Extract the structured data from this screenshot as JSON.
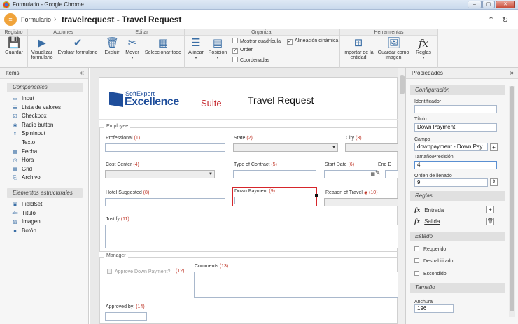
{
  "window": {
    "title": "Formulario - Google Chrome"
  },
  "header": {
    "breadcrumb": "Formulario",
    "separator": "›",
    "title": "travelrequest - Travel Request"
  },
  "ribbon": {
    "groups": {
      "registro": "Registro",
      "acciones": "Acciones",
      "editar": "Editar",
      "organizar": "Organizar",
      "herramientas": "Herramientas"
    },
    "buttons": {
      "guardar": "Guardar",
      "visualizar": "Visualizar formulario",
      "evaluar": "Evaluar formulario",
      "excluir": "Excluir",
      "mover": "Mover",
      "seleccionar": "Seleccionar todo",
      "alinear": "Alinear",
      "posicion": "Posición",
      "importar": "Importar de la entidad",
      "guardar_imagen": "Guardar como imagen",
      "reglas": "Reglas"
    },
    "checks": {
      "mostrar_cuadricula": {
        "label": "Mostrar cuadrícula",
        "checked": false
      },
      "orden": {
        "label": "Orden",
        "checked": true
      },
      "coordenadas": {
        "label": "Coordenadas",
        "checked": false
      },
      "alineacion": {
        "label": "Alineación dinámica",
        "checked": true
      }
    }
  },
  "items_panel": {
    "title": "Items",
    "components_title": "Componentes",
    "components": [
      {
        "icon": "input-icon",
        "label": "Input"
      },
      {
        "icon": "list-icon",
        "label": "Lista de valores"
      },
      {
        "icon": "checkbox-icon",
        "label": "Checkbox"
      },
      {
        "icon": "radio-icon",
        "label": "Radio button"
      },
      {
        "icon": "spin-icon",
        "label": "SpinInput"
      },
      {
        "icon": "text-icon",
        "label": "Texto"
      },
      {
        "icon": "calendar-icon",
        "label": "Fecha"
      },
      {
        "icon": "clock-icon",
        "label": "Hora"
      },
      {
        "icon": "grid-icon",
        "label": "Grid"
      },
      {
        "icon": "paperclip-icon",
        "label": "Archivo"
      }
    ],
    "structural_title": "Elementos estructurales",
    "structural": [
      {
        "icon": "fieldset-icon",
        "label": "FieldSet"
      },
      {
        "icon": "title-icon",
        "label": "Título"
      },
      {
        "icon": "image-icon",
        "label": "Imagen"
      },
      {
        "icon": "button-icon",
        "label": "Botón"
      }
    ]
  },
  "form": {
    "logo": {
      "line1": "SoftExpert",
      "line2": "Excellence",
      "line3": "Suite"
    },
    "title": "Travel Request",
    "employee_legend": "Employee",
    "manager_legend": "Manager",
    "fields": {
      "professional": {
        "label": "Professional",
        "num": "(1)"
      },
      "state": {
        "label": "State",
        "num": "(2)"
      },
      "city": {
        "label": "City",
        "num": "(3)"
      },
      "cost_center": {
        "label": "Cost Center",
        "num": "(4)"
      },
      "type_contract": {
        "label": "Type of Contract",
        "num": "(5)"
      },
      "start_date": {
        "label": "Start Date",
        "num": "(6)"
      },
      "end_date": {
        "label": "End D"
      },
      "hotel": {
        "label": "Hotel Suggested",
        "num": "(8)"
      },
      "down_payment": {
        "label": "Down Payment",
        "num": "(9)"
      },
      "reason": {
        "label": "Reason of Travel",
        "num": "(10)"
      },
      "justify": {
        "label": "Justify",
        "num": "(11)"
      },
      "approve": {
        "label": "Approve Down Payment?",
        "num": "(12)"
      },
      "comments": {
        "label": "Comments",
        "num": "(13)"
      },
      "approved_by": {
        "label": "Approved by:",
        "num": "(14)"
      }
    }
  },
  "properties_panel": {
    "title": "Propiedades",
    "config_title": "Configuración",
    "identificador": {
      "label": "Identificador",
      "value": ""
    },
    "titulo": {
      "label": "Título",
      "value": "Down Payment"
    },
    "campo": {
      "label": "Campo",
      "value": "downpayment - Down Pay"
    },
    "tamano": {
      "label": "Tamaño/Precisión",
      "value": "4"
    },
    "orden": {
      "label": "Orden de llenado",
      "value": "9"
    },
    "reglas_title": "Reglas",
    "rules": {
      "fx": "fx",
      "entrada": "Entrada",
      "salida": "Salida"
    },
    "estado_title": "Estado",
    "estado": {
      "requerido": "Requerido",
      "deshabilitado": "Deshabilitado",
      "escondido": "Escondido"
    },
    "tamano_title": "Tamaño",
    "anchura": {
      "label": "Anchura",
      "value": "196"
    }
  },
  "colors": {
    "accent": "#3a6ea5",
    "selection": "#d6262b",
    "brand": "#1f4e9b"
  }
}
